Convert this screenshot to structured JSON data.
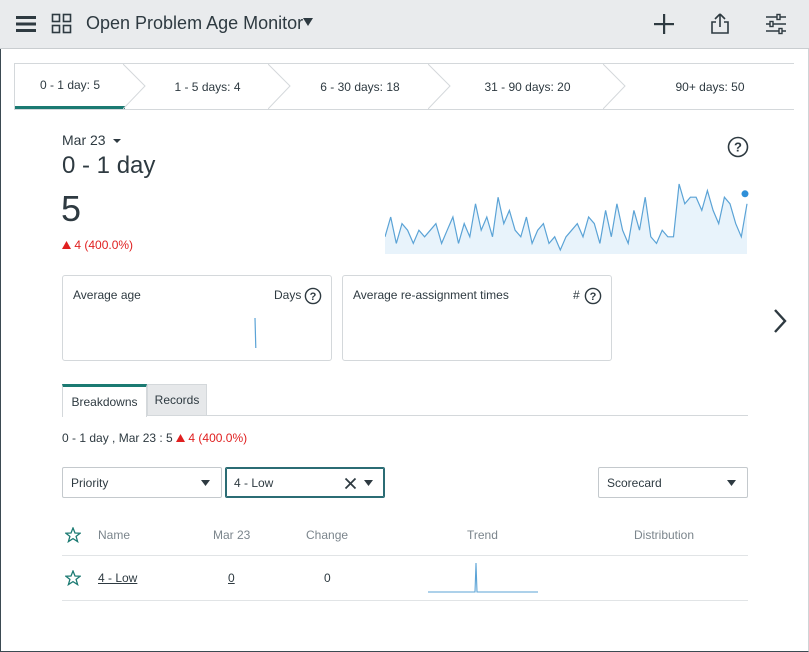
{
  "header": {
    "title": "Open Problem Age Monitor",
    "icons": [
      "menu-icon",
      "grid-icon",
      "add-icon",
      "share-icon",
      "settings-sliders-icon"
    ]
  },
  "chevrons": [
    {
      "label": "0 - 1 day: 5",
      "active": true
    },
    {
      "label": "1 - 5 days: 4",
      "active": false
    },
    {
      "label": "6 - 30 days: 18",
      "active": false
    },
    {
      "label": "31 - 90 days: 20",
      "active": false
    },
    {
      "label": "90+ days: 50",
      "active": false
    }
  ],
  "score": {
    "date": "Mar 23",
    "title": "0 - 1 day",
    "value": "5",
    "delta": "4 (400.0%)",
    "trend_values": [
      2,
      5,
      1,
      4,
      3,
      1,
      3,
      2,
      3,
      4,
      1,
      3,
      5,
      1,
      4,
      2,
      7,
      3,
      5,
      2,
      8,
      4,
      6,
      3,
      2,
      5,
      1,
      3,
      4,
      1,
      2,
      0,
      2,
      3,
      4,
      2,
      5,
      4,
      1,
      6,
      2,
      7,
      3,
      1,
      6,
      3,
      8,
      2,
      1,
      3,
      2,
      2,
      10,
      7,
      8,
      8,
      6,
      9,
      6,
      4,
      8,
      7,
      4,
      2,
      7
    ]
  },
  "cards": [
    {
      "title": "Average age",
      "unit": "Days"
    },
    {
      "title": "Average re-assignment times",
      "unit": "#"
    }
  ],
  "tabs": [
    {
      "label": "Breakdowns",
      "active": true
    },
    {
      "label": "Records",
      "active": false
    }
  ],
  "summary": {
    "prefix": "0 - 1 day , Mar 23 : 5",
    "delta": "4 (400.0%)"
  },
  "filters": {
    "breakdown": "Priority",
    "element": "4 - Low",
    "view": "Scorecard"
  },
  "table": {
    "headers": [
      "Name",
      "Mar 23",
      "Change",
      "Trend",
      "Distribution"
    ],
    "rows": [
      {
        "name": "4 - Low",
        "value": "0",
        "change": "0"
      }
    ]
  },
  "colors": {
    "accent": "#1b7a72",
    "sparkline": "#5ba3d6",
    "negative": "#e02020"
  }
}
